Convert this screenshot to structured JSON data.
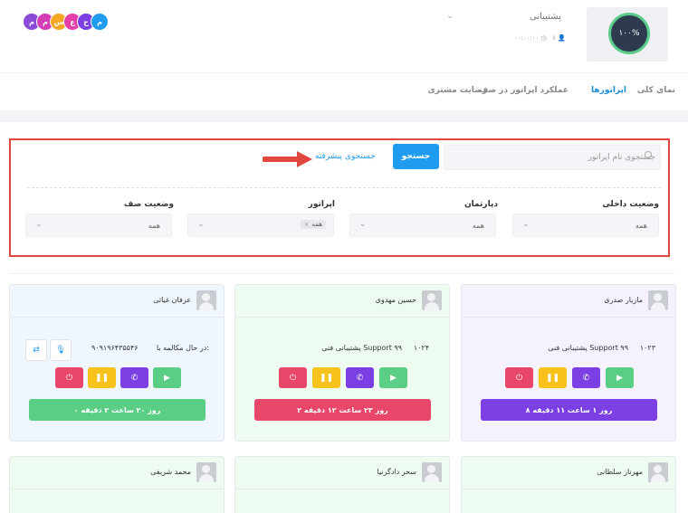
{
  "header": {
    "badges": [
      {
        "letter": "م",
        "color": "#8b4bd8"
      },
      {
        "letter": "م",
        "color": "#d23cb4"
      },
      {
        "letter": "س",
        "color": "#f5a623"
      },
      {
        "letter": "ع",
        "color": "#e63ea8"
      },
      {
        "letter": "ح",
        "color": "#7b3fe4"
      },
      {
        "letter": "م",
        "color": "#1f9bf0"
      }
    ],
    "queue_name": "پشتیبانی",
    "queue_percent": "۱۰۰%",
    "queue_count": "۶",
    "queue_time": "۰۰:۰۰:۰۰"
  },
  "tabs": [
    {
      "label": "نمای کلی"
    },
    {
      "label": "اپراتورها"
    },
    {
      "label": "عملکرد اپراتور در صف"
    },
    {
      "label": "رضایت مشتری"
    }
  ],
  "search": {
    "placeholder": "جستجوی نام اپراتور",
    "button_label": "جستجو",
    "advanced_label": "جستجوی پیشرفته"
  },
  "filters": [
    {
      "label": "وضعیت داخلی",
      "value": "همه"
    },
    {
      "label": "دپارتمان",
      "value": "همه"
    },
    {
      "label": "اپراتور",
      "value": "همه"
    },
    {
      "label": "وضعیت صف",
      "value": "همه"
    }
  ],
  "operators": [
    {
      "name": "مازیار صدری",
      "ext": "۱۰۲۳",
      "queue": "پشتیبانی فنی Support ۹۹",
      "status": "۸ روز ۱ ساعت ۱۱ دقیقه",
      "status_color": "#7b3fe4",
      "bg": "#f5f2fe"
    },
    {
      "name": "حسین مهدوی",
      "ext": "۱۰۲۴",
      "queue": "پشتیبانی فنی Support ۹۹",
      "status": "۲ روز ۲۳ ساعت ۱۲ دقیقه",
      "status_color": "#e8476a",
      "bg": "#eefbf0"
    },
    {
      "name": "عرفان غیاثی",
      "in_call_label": "در حال مکالمه با:",
      "phone": "۹۰۹۱۹۶۴۳۵۵۴۶",
      "status": "۰ روز ۲۰ ساعت ۲ دقیقه",
      "status_color": "#5bce85",
      "bg": "#eff6fd"
    },
    {
      "name": "مهرناز سلطانی",
      "bg": "#eefbf0"
    },
    {
      "name": "سحر دادگرنیا",
      "bg": "#eefbf0"
    },
    {
      "name": "محمد شریفی",
      "bg": "#eefbf0"
    }
  ],
  "controls": {
    "colors": {
      "power": "#e8476a",
      "pause": "#f7c21b",
      "call": "#7b3fe4",
      "play": "#5bce85"
    }
  }
}
